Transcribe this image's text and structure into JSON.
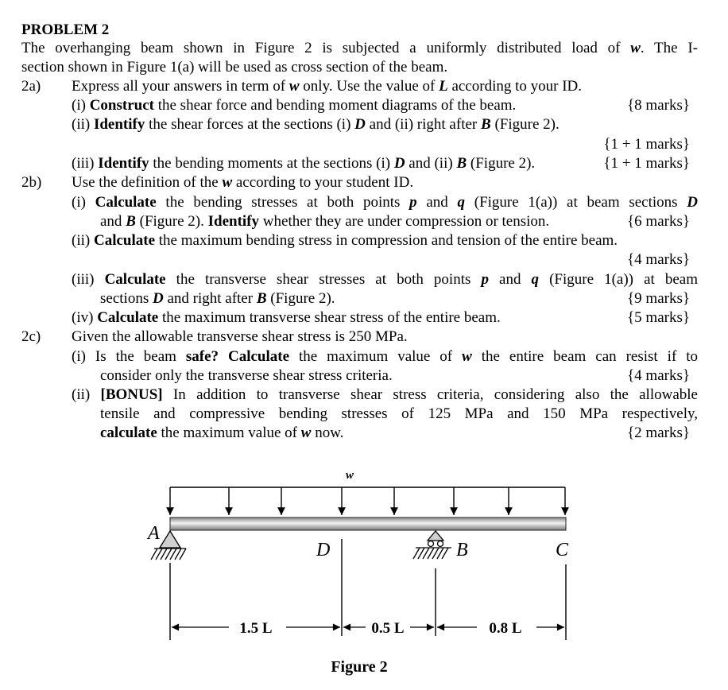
{
  "lines": [
    {
      "segs": [
        {
          "t": "PROBLEM 2",
          "s": "b"
        }
      ]
    },
    {
      "segs": [
        {
          "t": "The overhanging beam shown in Figure 2 is subjected a uniformly distributed load of ",
          "s": ""
        },
        {
          "t": "w",
          "s": "bi"
        },
        {
          "t": ". The I-",
          "s": ""
        }
      ]
    },
    {
      "segs": [
        {
          "t": "section shown in Figure 1(a) will be used as cross section of the beam.",
          "s": ""
        }
      ]
    },
    {
      "label": "2a)",
      "segs": [
        {
          "t": "Express all your answers in term of ",
          "s": ""
        },
        {
          "t": "w",
          "s": "bi"
        },
        {
          "t": " only. Use the value of ",
          "s": ""
        },
        {
          "t": "L",
          "s": "bi"
        },
        {
          "t": " according to your ID.",
          "s": ""
        }
      ]
    },
    {
      "segs": [
        {
          "t": "(i) ",
          "s": ""
        },
        {
          "t": "Construct",
          "s": "b"
        },
        {
          "t": " the shear force and bending moment diagrams of the beam.",
          "s": ""
        }
      ],
      "marks": "{8 marks}"
    },
    {
      "segs": [
        {
          "t": "(ii) ",
          "s": ""
        },
        {
          "t": "Identify",
          "s": "b"
        },
        {
          "t": " the shear forces at the sections (i) ",
          "s": ""
        },
        {
          "t": "D",
          "s": "bi"
        },
        {
          "t": " and (ii) right after ",
          "s": ""
        },
        {
          "t": "B",
          "s": "bi"
        },
        {
          "t": " (Figure 2).",
          "s": ""
        }
      ]
    },
    {
      "segs": [],
      "marks": "{1 + 1 marks}"
    },
    {
      "segs": [
        {
          "t": "(iii) ",
          "s": ""
        },
        {
          "t": "Identify",
          "s": "b"
        },
        {
          "t": " the bending moments at the sections (i) ",
          "s": ""
        },
        {
          "t": "D",
          "s": "bi"
        },
        {
          "t": " and (ii) ",
          "s": ""
        },
        {
          "t": "B",
          "s": "bi"
        },
        {
          "t": " (Figure 2).",
          "s": ""
        }
      ],
      "marks": "{1 + 1 marks}"
    },
    {
      "label": "2b)",
      "segs": [
        {
          "t": "Use the definition of the ",
          "s": ""
        },
        {
          "t": "w",
          "s": "bi"
        },
        {
          "t": " according to your student ID.",
          "s": ""
        }
      ]
    },
    {
      "segs": [
        {
          "t": "(i) ",
          "s": ""
        },
        {
          "t": "Calculate",
          "s": "b"
        },
        {
          "t": " the bending stresses at both points ",
          "s": ""
        },
        {
          "t": "p",
          "s": "bi"
        },
        {
          "t": " and ",
          "s": ""
        },
        {
          "t": "q",
          "s": "bi"
        },
        {
          "t": " (Figure 1(a)) at beam sections ",
          "s": ""
        },
        {
          "t": "D",
          "s": "bi"
        }
      ]
    },
    {
      "segs": [
        {
          "t": "and ",
          "s": ""
        },
        {
          "t": "B",
          "s": "bi"
        },
        {
          "t": " (Figure 2). ",
          "s": ""
        },
        {
          "t": "Identify",
          "s": "b"
        },
        {
          "t": " whether they are under compression or tension.",
          "s": ""
        }
      ],
      "marks": "{6 marks}"
    },
    {
      "segs": [
        {
          "t": "(ii) ",
          "s": ""
        },
        {
          "t": "Calculate",
          "s": "b"
        },
        {
          "t": " the maximum bending stress in compression and tension of the entire beam.",
          "s": ""
        }
      ]
    },
    {
      "segs": [],
      "marks": "{4 marks}"
    },
    {
      "segs": [
        {
          "t": "(iii) ",
          "s": ""
        },
        {
          "t": "Calculate",
          "s": "b"
        },
        {
          "t": " the transverse shear stresses at both points ",
          "s": ""
        },
        {
          "t": "p",
          "s": "bi"
        },
        {
          "t": " and ",
          "s": ""
        },
        {
          "t": "q",
          "s": "bi"
        },
        {
          "t": " (Figure 1(a)) at beam",
          "s": ""
        }
      ]
    },
    {
      "segs": [
        {
          "t": "sections ",
          "s": ""
        },
        {
          "t": "D",
          "s": "bi"
        },
        {
          "t": " and right after ",
          "s": ""
        },
        {
          "t": "B",
          "s": "bi"
        },
        {
          "t": " (Figure 2).",
          "s": ""
        }
      ],
      "marks": "{9 marks}"
    },
    {
      "segs": [
        {
          "t": "(iv) ",
          "s": ""
        },
        {
          "t": "Calculate",
          "s": "b"
        },
        {
          "t": " the maximum transverse shear stress of the entire beam.",
          "s": ""
        }
      ],
      "marks": "{5 marks}"
    },
    {
      "label": "2c)",
      "segs": [
        {
          "t": "Given the allowable transverse shear stress is 250 MPa.",
          "s": ""
        }
      ]
    },
    {
      "segs": [
        {
          "t": "(i) Is the beam ",
          "s": ""
        },
        {
          "t": "safe?",
          "s": "b"
        },
        {
          "t": " ",
          "s": ""
        },
        {
          "t": "Calculate",
          "s": "b"
        },
        {
          "t": " the maximum value of ",
          "s": ""
        },
        {
          "t": "w",
          "s": "bi"
        },
        {
          "t": " the entire beam can resist if to",
          "s": ""
        }
      ]
    },
    {
      "segs": [
        {
          "t": "consider only the transverse shear stress criteria.",
          "s": ""
        }
      ],
      "marks": "{4 marks}"
    },
    {
      "segs": [
        {
          "t": "(ii) ",
          "s": ""
        },
        {
          "t": "[BONUS]",
          "s": "b"
        },
        {
          "t": " In addition to transverse shear stress criteria, considering also the allowable",
          "s": ""
        }
      ]
    },
    {
      "segs": [
        {
          "t": "tensile and compressive bending stresses of 125 MPa and 150 MPa respectively,",
          "s": ""
        }
      ]
    },
    {
      "segs": [
        {
          "t": "calculate",
          "s": "b"
        },
        {
          "t": " the maximum value of ",
          "s": ""
        },
        {
          "t": "w",
          "s": "bi"
        },
        {
          "t": " now.",
          "s": ""
        }
      ],
      "marks": "{2 marks}"
    }
  ],
  "figure": {
    "load_label": "w",
    "points": {
      "A": "A",
      "D": "D",
      "B": "B",
      "C": "C"
    },
    "dims": [
      "1.5 L",
      "0.5 L",
      "0.8 L"
    ],
    "caption": "Figure 2"
  }
}
